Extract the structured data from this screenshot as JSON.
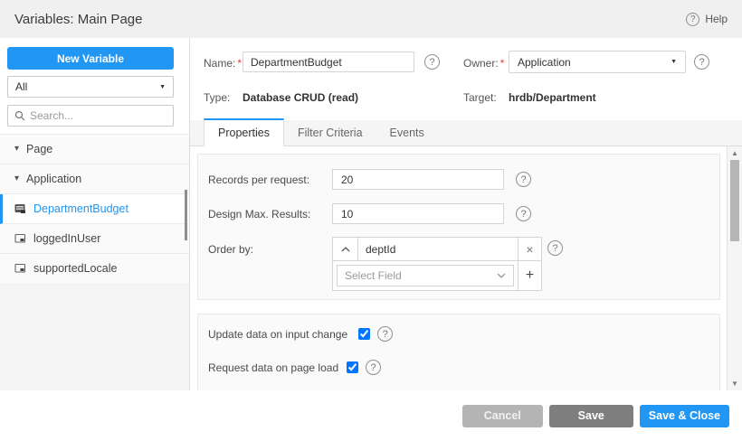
{
  "header": {
    "title": "Variables: Main Page",
    "help_label": "Help"
  },
  "sidebar": {
    "new_variable_label": "New Variable",
    "filter_value": "All",
    "search_placeholder": "Search...",
    "tree": [
      {
        "label": "Page",
        "type": "group",
        "expanded": true
      },
      {
        "label": "Application",
        "type": "group",
        "expanded": true
      },
      {
        "label": "DepartmentBudget",
        "type": "crud-variable",
        "selected": true
      },
      {
        "label": "loggedInUser",
        "type": "variable",
        "selected": false
      },
      {
        "label": "supportedLocale",
        "type": "variable",
        "selected": false
      }
    ]
  },
  "details": {
    "required_marker": "*",
    "name_label": "Name:",
    "name_value": "DepartmentBudget",
    "owner_label": "Owner:",
    "owner_value": "Application",
    "type_label": "Type:",
    "type_value": "Database CRUD (read)",
    "target_label": "Target:",
    "target_value": "hrdb/Department"
  },
  "tabs": [
    {
      "label": "Properties",
      "active": true
    },
    {
      "label": "Filter Criteria",
      "active": false
    },
    {
      "label": "Events",
      "active": false
    }
  ],
  "properties": {
    "records_per_request": {
      "label": "Records per request:",
      "value": "20"
    },
    "design_max_results": {
      "label": "Design Max. Results:",
      "value": "10"
    },
    "order_by": {
      "label": "Order by:",
      "field": "deptId",
      "select_placeholder": "Select Field"
    },
    "update_on_input": {
      "label": "Update data on input change",
      "checked": true
    },
    "request_on_load": {
      "label": "Request data on page load",
      "checked": true
    }
  },
  "footer": {
    "cancel_label": "Cancel",
    "save_label": "Save",
    "save_close_label": "Save & Close"
  },
  "colors": {
    "accent": "#2196f3",
    "cancel_gray": "#b4b4b4",
    "save_gray": "#7f7f7f",
    "required_red": "#e53935"
  }
}
